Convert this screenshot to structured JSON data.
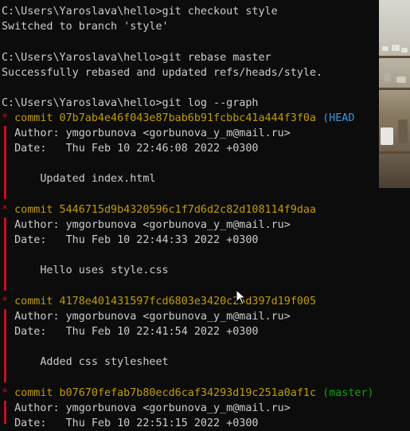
{
  "lines": [
    {
      "text": "C:\\Users\\Yaroslava\\hello>git checkout style"
    },
    {
      "text": "Switched to branch 'style'"
    },
    {
      "text": ""
    },
    {
      "text": "C:\\Users\\Yaroslava\\hello>git rebase master"
    },
    {
      "text": "Successfully rebased and updated refs/heads/style."
    },
    {
      "text": ""
    },
    {
      "text": "C:\\Users\\Yaroslava\\hello>git log --graph"
    }
  ],
  "commits": [
    {
      "prefix": "* ",
      "hash_text": "commit 07b7ab4e46f043e87bab6b91fcbbc41a444f3f0a",
      "ref_text": " (HEAD",
      "author": "  Author: ymgorbunova <gorbunova_y_m@mail.ru>",
      "date": "  Date:   Thu Feb 10 22:46:08 2022 +0300",
      "message": "      Updated index.html"
    },
    {
      "prefix": "* ",
      "hash_text": "commit 5446715d9b4320596c1f7d6d2c82d108114f9daa",
      "ref_text": "",
      "author": "  Author: ymgorbunova <gorbunova_y_m@mail.ru>",
      "date": "  Date:   Thu Feb 10 22:44:33 2022 +0300",
      "message": "      Hello uses style.css"
    },
    {
      "prefix": "* ",
      "hash_text": "commit 4178e401431597fcd6803e3420c25d397d19f005",
      "ref_text": "",
      "author": "  Author: ymgorbunova <gorbunova_y_m@mail.ru>",
      "date": "  Date:   Thu Feb 10 22:41:54 2022 +0300",
      "message": "      Added css stylesheet"
    },
    {
      "prefix": "* ",
      "hash_text": "commit b07670fefab7b80ecd6caf34293d19c251a0af1c",
      "ref_text": " (master)",
      "author": "  Author: ymgorbunova <gorbunova_y_m@mail.ru>",
      "date": "  Date:   Thu Feb 10 22:51:15 2022 +0300",
      "message": ""
    }
  ],
  "colors": {
    "background": "#0c0c0c",
    "text": "#cccccc",
    "commit_hash": "#c19c00",
    "head_ref": "#3a96dd",
    "master_ref": "#13a10e",
    "graph": "#c50f1f"
  },
  "icons": {
    "pointer": "mouse-pointer-icon"
  }
}
